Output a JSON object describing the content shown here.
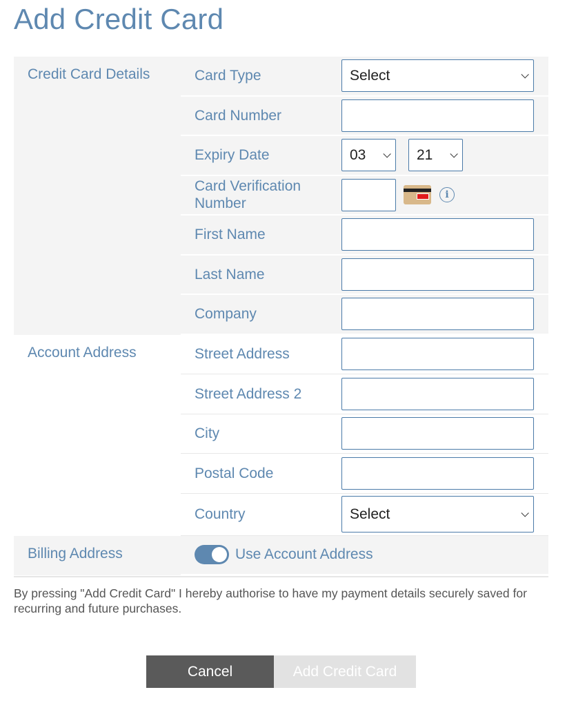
{
  "page": {
    "title": "Add Credit Card"
  },
  "sections": {
    "credit_card": {
      "label": "Credit Card Details",
      "card_type": {
        "label": "Card Type",
        "value": "Select"
      },
      "card_number": {
        "label": "Card Number",
        "value": ""
      },
      "expiry": {
        "label": "Expiry Date",
        "month": "03",
        "year": "21"
      },
      "cvv": {
        "label_line1": "Card Verification",
        "label_line2": "Number",
        "value": ""
      },
      "first_name": {
        "label": "First Name",
        "value": ""
      },
      "last_name": {
        "label": "Last Name",
        "value": ""
      },
      "company": {
        "label": "Company",
        "value": ""
      }
    },
    "account_address": {
      "label": "Account Address",
      "street": {
        "label": "Street Address",
        "value": ""
      },
      "street2": {
        "label": "Street Address 2",
        "value": ""
      },
      "city": {
        "label": "City",
        "value": ""
      },
      "postal": {
        "label": "Postal Code",
        "value": ""
      },
      "country": {
        "label": "Country",
        "value": "Select"
      }
    },
    "billing_address": {
      "label": "Billing Address",
      "toggle_label": "Use Account Address",
      "toggle_on": true
    }
  },
  "notice": "By pressing \"Add Credit Card\" I hereby authorise to have my payment details securely saved for recurring and future purchases.",
  "buttons": {
    "cancel": "Cancel",
    "add": "Add Credit Card"
  },
  "icons": {
    "cvv_card": "credit-card-back-icon",
    "info": "info-icon"
  },
  "colors": {
    "accent": "#5e88b0",
    "border": "#4a7aa8",
    "section_bg": "#f4f4f4",
    "cancel_bg": "#5a5a5a",
    "add_bg_disabled": "#e2e2e2"
  }
}
